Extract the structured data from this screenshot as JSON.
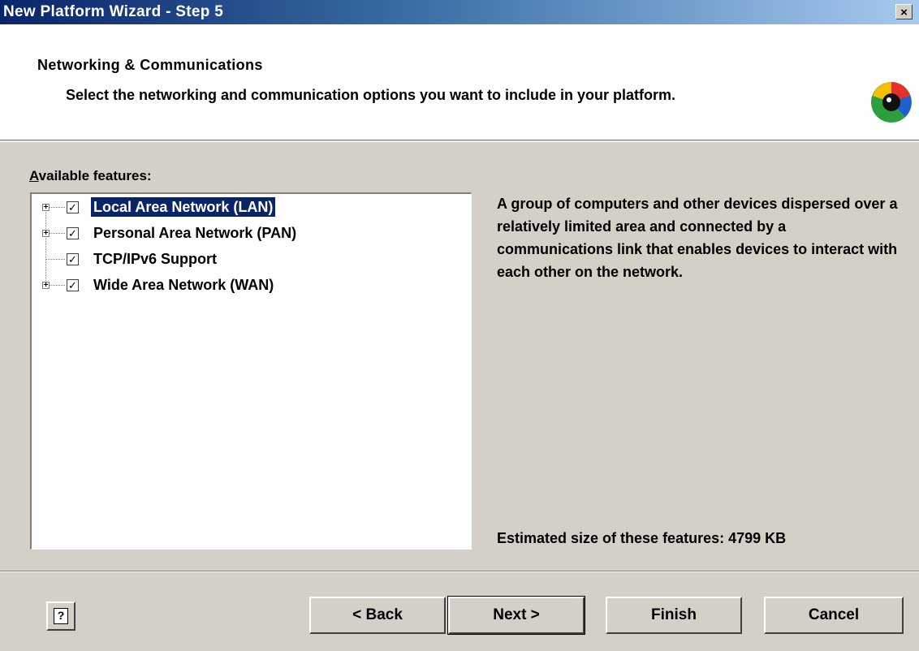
{
  "window": {
    "title": "New Platform Wizard - Step 5",
    "close_label": "×"
  },
  "header": {
    "title": "Networking & Communications",
    "subtitle": "Select the networking and communication options you want to include in your platform."
  },
  "features": {
    "label_prefix": "A",
    "label_rest": "vailable features:",
    "items": [
      {
        "label": "Local Area Network (LAN)",
        "checked": true,
        "expandable": true,
        "selected": true
      },
      {
        "label": "Personal Area Network (PAN)",
        "checked": true,
        "expandable": true,
        "selected": false
      },
      {
        "label": "TCP/IPv6 Support",
        "checked": true,
        "expandable": false,
        "selected": false
      },
      {
        "label": "Wide Area Network (WAN)",
        "checked": true,
        "expandable": true,
        "selected": false
      }
    ]
  },
  "description": "A group of computers and other devices dispersed over a relatively limited area and connected by a communications link that enables devices to interact with each other on the network.",
  "estimated_size": "Estimated size of these features: 4799 KB",
  "buttons": {
    "help": "?",
    "back": "< Back",
    "next": "Next >",
    "finish": "Finish",
    "cancel": "Cancel"
  },
  "icons": {
    "expand": "+",
    "check": "✓",
    "wizard_logo": "wizard-logo-icon"
  }
}
